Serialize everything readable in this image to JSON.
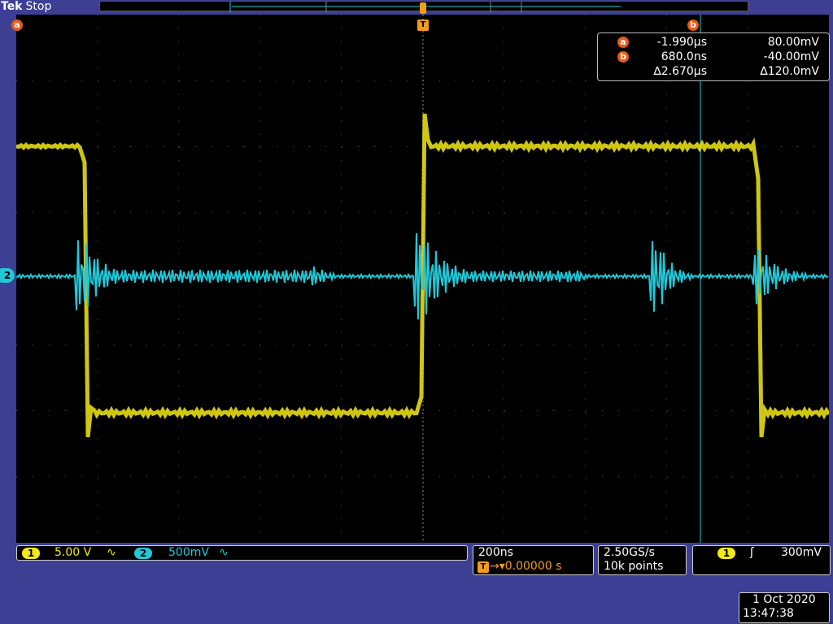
{
  "header": {
    "brand": "Tek",
    "run_state": "Stop"
  },
  "markers": {
    "cursor_a": "a",
    "cursor_b": "b",
    "trigger": "T",
    "ch2": "2"
  },
  "cursor_readout": {
    "a": {
      "label": "a",
      "time": "-1.990µs",
      "value": "80.00mV"
    },
    "b": {
      "label": "b",
      "time": "680.0ns",
      "value": "-40.00mV"
    },
    "delta": {
      "time": "∆2.670µs",
      "value": "∆120.0mV"
    }
  },
  "channels": {
    "ch1": {
      "number": "1",
      "scale": "5.00 V",
      "coupling": "∿",
      "color": "#f3e915"
    },
    "ch2": {
      "number": "2",
      "scale": "500mV",
      "coupling": "∿",
      "color": "#21c8d8"
    }
  },
  "timebase": {
    "scale": "200ns",
    "trigger_label": "T",
    "position": "→▾0.00000 s"
  },
  "acquisition": {
    "sample_rate": "2.50GS/s",
    "record_length": "10k points"
  },
  "trigger": {
    "source": "1",
    "slope": "ʃ",
    "level": "300mV"
  },
  "datetime": {
    "date": "1 Oct  2020",
    "time": "13:47:38"
  },
  "colors": {
    "background": "#3c3f93",
    "screen": "#000000",
    "ch1": "#f3e915",
    "ch2": "#21c8d8",
    "cursor": "#e85a1a",
    "trigger": "#f39b1a"
  }
}
